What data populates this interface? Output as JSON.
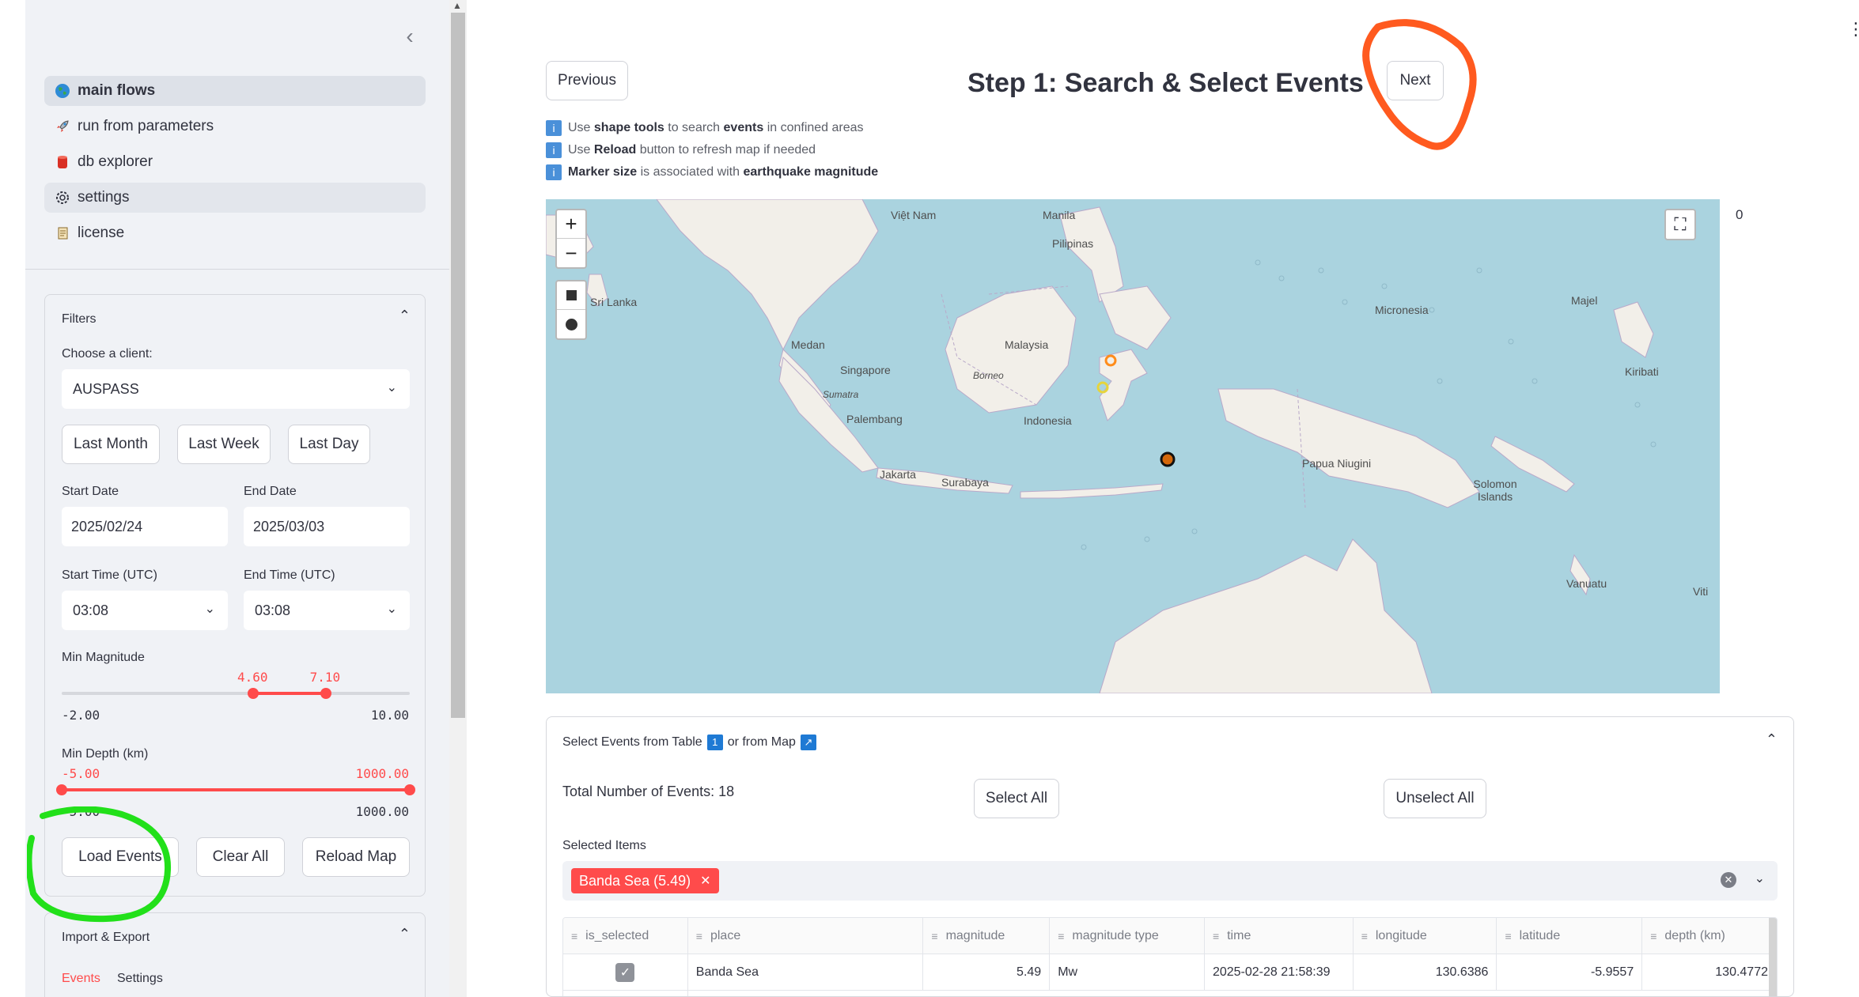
{
  "sidebar": {
    "nav": [
      {
        "label": "main flows",
        "icon": "globe-icon"
      },
      {
        "label": "run from parameters",
        "icon": "rocket-icon"
      },
      {
        "label": "db explorer",
        "icon": "database-icon"
      },
      {
        "label": "settings",
        "icon": "gear-icon"
      },
      {
        "label": "license",
        "icon": "scroll-icon"
      }
    ],
    "filters": {
      "title": "Filters",
      "client_label": "Choose a client:",
      "client_value": "AUSPASS",
      "quick_buttons": [
        "Last Month",
        "Last Week",
        "Last Day"
      ],
      "start_date_label": "Start Date",
      "start_date": "2025/02/24",
      "end_date_label": "End Date",
      "end_date": "2025/03/03",
      "start_time_label": "Start Time (UTC)",
      "start_time": "03:08",
      "end_time_label": "End Time (UTC)",
      "end_time": "03:08",
      "magnitude": {
        "label": "Min Magnitude",
        "min": -2.0,
        "max": 10.0,
        "low": 4.6,
        "high": 7.1,
        "low_text": "4.60",
        "high_text": "7.10",
        "min_text": "-2.00",
        "max_text": "10.00"
      },
      "depth": {
        "label": "Min Depth (km)",
        "min": -5.0,
        "max": 1000.0,
        "low": -5.0,
        "high": 1000.0,
        "low_text": "-5.00",
        "high_text": "1000.00",
        "min_text": "-5.00",
        "max_text": "1000.00"
      },
      "load_button": "Load Events",
      "clear_button": "Clear All",
      "reload_button": "Reload Map"
    },
    "import_export": {
      "title": "Import & Export",
      "tabs": [
        "Events",
        "Settings"
      ]
    }
  },
  "main": {
    "previous_button": "Previous",
    "next_button": "Next",
    "title": "Step 1: Search & Select Events",
    "info": [
      {
        "pre": "Use ",
        "b1": "shape tools",
        "mid": " to search ",
        "b2": "events",
        "post": " in confined areas"
      },
      {
        "pre": "Use ",
        "b1": "Reload",
        "mid": " button to refresh map if needed",
        "b2": "",
        "post": ""
      },
      {
        "pre": "",
        "b1": "Marker size",
        "mid": " is associated with ",
        "b2": "earthquake magnitude",
        "post": ""
      }
    ],
    "map": {
      "zoom_in": "+",
      "zoom_out": "−",
      "counter": "0",
      "labels": [
        "Việt Nam",
        "Manila",
        "Pilipinas",
        "Sri Lanka",
        "Medan",
        "Singapore",
        "Sumatra",
        "Malaysia",
        "Borneo",
        "Indonesia",
        "Palembang",
        "Jakarta",
        "Surabaya",
        "Micronesia",
        "Majel",
        "Kiribati",
        "Papua Niugini",
        "Solomon Islands",
        "Vanuatu",
        "Viti"
      ]
    },
    "table_panel": {
      "title_pre": "Select Events from Table",
      "title_mid": "or from Map",
      "total": "Total Number of Events: 18",
      "select_all": "Select All",
      "unselect_all": "Unselect All",
      "selected_label": "Selected Items",
      "chip": "Banda Sea (5.49)",
      "columns": [
        "is_selected",
        "place",
        "magnitude",
        "magnitude type",
        "time",
        "longitude",
        "latitude",
        "depth (km)"
      ],
      "rows": [
        {
          "is_selected": true,
          "place": "Banda Sea",
          "magnitude": "5.49",
          "magnitude_type": "Mw",
          "time": "2025-02-28 21:58:39",
          "longitude": "130.6386",
          "latitude": "-5.9557",
          "depth": "130.4772"
        }
      ]
    }
  },
  "colors": {
    "accent": "#ff4b4b",
    "annotation_orange": "#ff5a1f",
    "annotation_green": "#22e01a"
  }
}
